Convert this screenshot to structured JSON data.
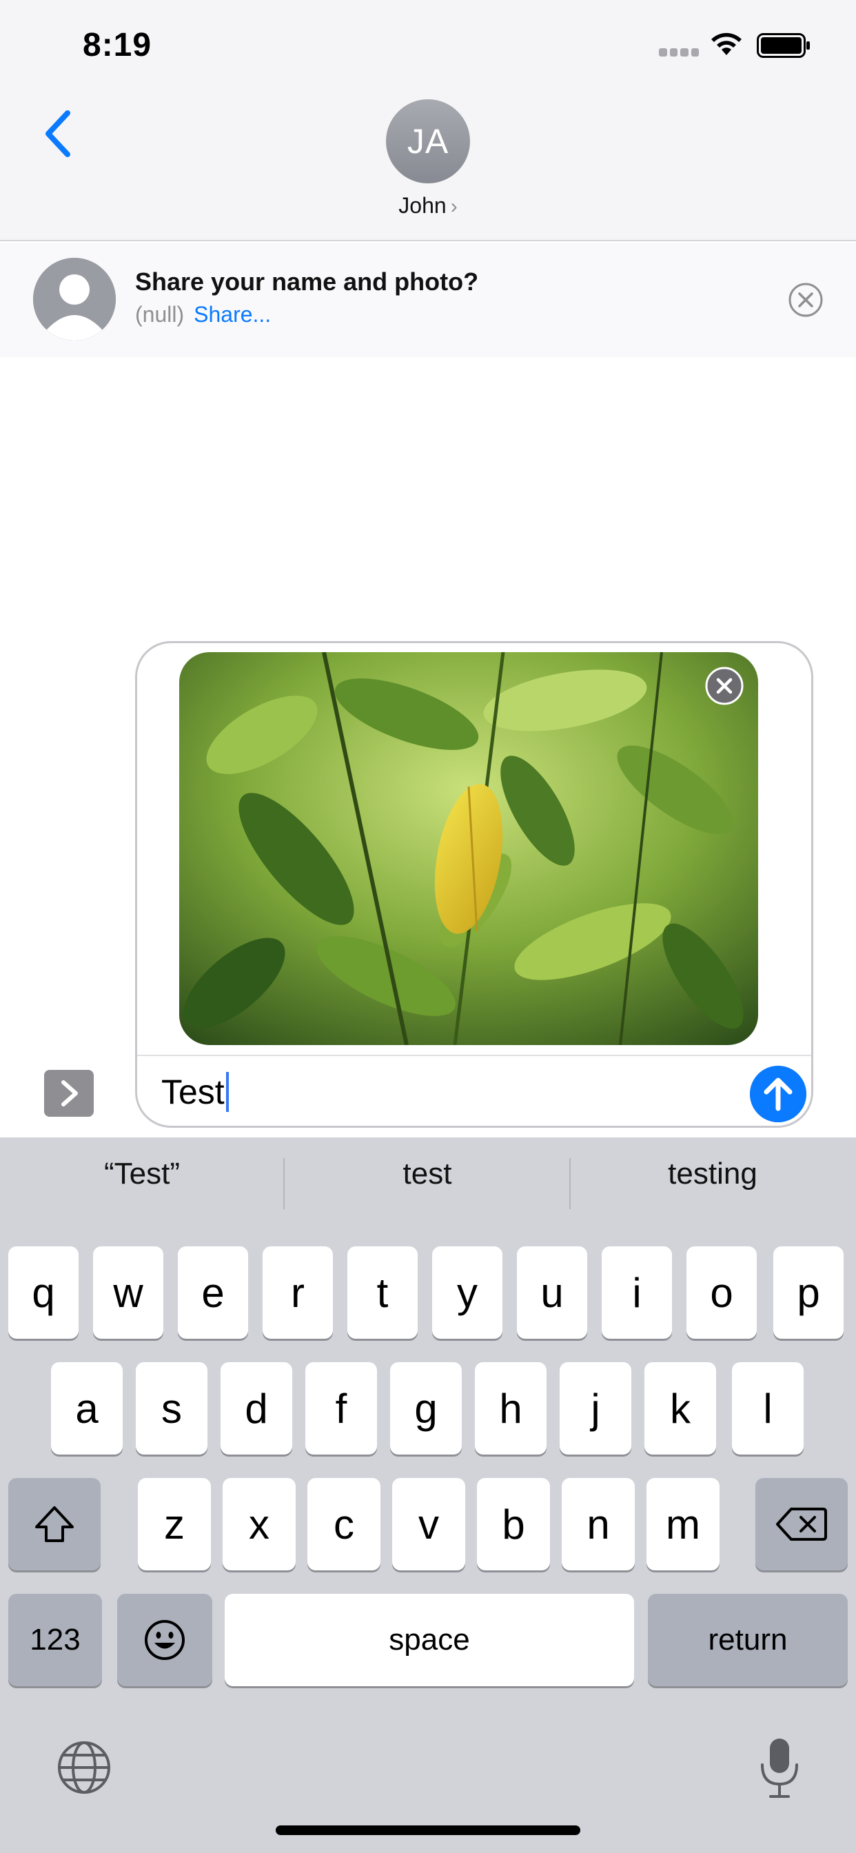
{
  "status_bar": {
    "time": "8:19"
  },
  "header": {
    "avatar_initials": "JA",
    "contact_name": "John",
    "chevron": "›"
  },
  "share_banner": {
    "title": "Share your name and photo?",
    "subtitle": "(null)",
    "link": "Share..."
  },
  "compose": {
    "text": "Test",
    "attachment": "photo of green leaves with a yellow leaf"
  },
  "keyboard": {
    "suggestions": [
      "“Test”",
      "test",
      "testing"
    ],
    "row1": [
      "q",
      "w",
      "e",
      "r",
      "t",
      "y",
      "u",
      "i",
      "o",
      "p"
    ],
    "row2": [
      "a",
      "s",
      "d",
      "f",
      "g",
      "h",
      "j",
      "k",
      "l"
    ],
    "row3": [
      "z",
      "x",
      "c",
      "v",
      "b",
      "n",
      "m"
    ],
    "numbers_label": "123",
    "space_label": "space",
    "return_label": "return"
  },
  "colors": {
    "accent_blue": "#0a7aff",
    "keyboard_bg": "#d1d3d9",
    "avatar_gray": "#8e9097"
  },
  "icons": [
    "back-chevron-icon",
    "wifi-icon",
    "battery-icon",
    "signal-icon",
    "close-circle-icon",
    "expand-chevron-icon",
    "send-arrow-icon",
    "shift-icon",
    "delete-icon",
    "emoji-icon",
    "globe-icon",
    "microphone-icon"
  ]
}
